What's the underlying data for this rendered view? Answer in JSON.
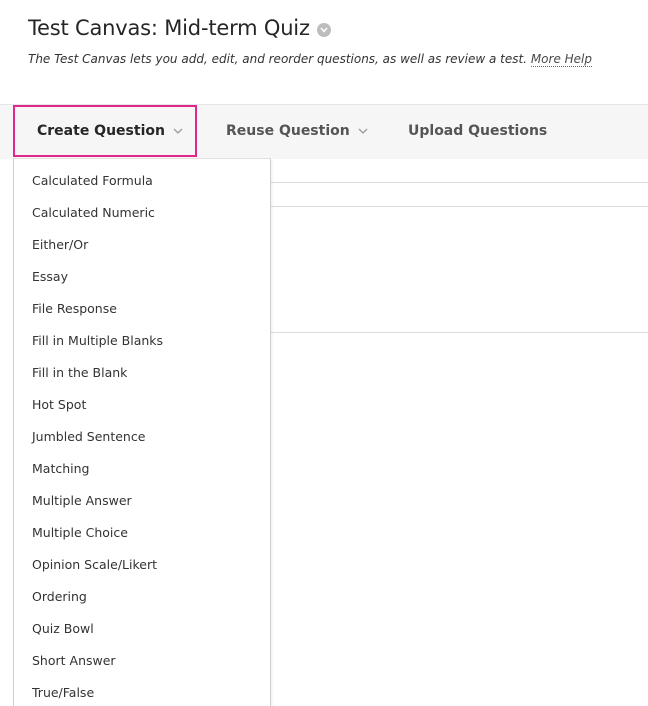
{
  "header": {
    "title": "Test Canvas: Mid-term Quiz",
    "description": "The Test Canvas lets you add, edit, and reorder questions, as well as review a test.",
    "more_help": "More Help"
  },
  "action_bar": {
    "create_question": "Create Question",
    "reuse_question": "Reuse Question",
    "upload_questions": "Upload Questions"
  },
  "dropdown": {
    "items": [
      "Calculated Formula",
      "Calculated Numeric",
      "Either/Or",
      "Essay",
      "File Response",
      "Fill in Multiple Blanks",
      "Fill in the Blank",
      "Hot Spot",
      "Jumbled Sentence",
      "Matching",
      "Multiple Answer",
      "Multiple Choice",
      "Opinion Scale/Likert",
      "Ordering",
      "Quiz Bowl",
      "Short Answer",
      "True/False"
    ]
  },
  "colors": {
    "highlight_border": "#e0288a",
    "action_bar_bg": "#f6f6f6"
  }
}
